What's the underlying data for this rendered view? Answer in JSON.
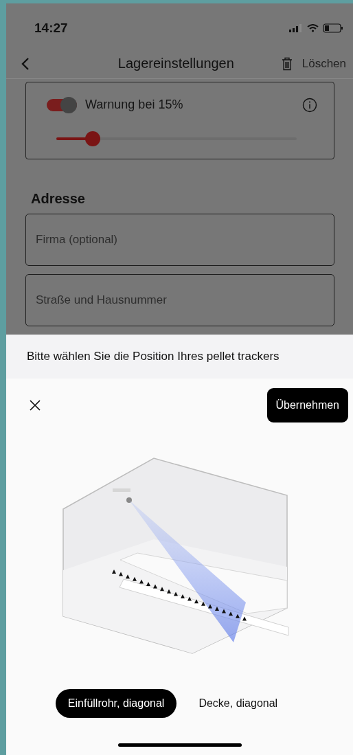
{
  "status_bar": {
    "time": "14:27"
  },
  "nav": {
    "title": "Lagereinstellungen",
    "delete_label": "Löschen"
  },
  "warning": {
    "label": "Warnung bei 15%",
    "on": true,
    "level": 0.15
  },
  "address": {
    "heading": "Adresse",
    "fields": [
      {
        "placeholder": "Firma (optional)"
      },
      {
        "placeholder": "Straße und Hausnummer"
      }
    ]
  },
  "sheet": {
    "prompt": "Bitte wählen Sie die Position Ihres pellet trackers",
    "apply_button": "Übernehmen",
    "options": [
      {
        "label": "Einfüllrohr, diagonal",
        "selected": true
      },
      {
        "label": "Decke, diagonal",
        "selected": false
      }
    ]
  }
}
